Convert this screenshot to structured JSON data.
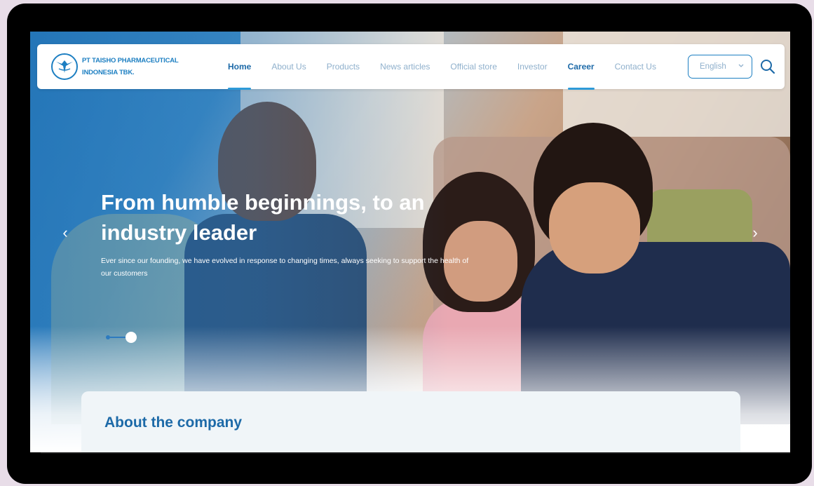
{
  "company": {
    "name_line1": "PT TAISHO PHARMACEUTICAL",
    "name_line2": "INDONESIA TBK."
  },
  "nav": {
    "items": [
      {
        "label": "Home",
        "active": true
      },
      {
        "label": "About Us",
        "active": false
      },
      {
        "label": "Products",
        "active": false
      },
      {
        "label": "News articles",
        "active": false
      },
      {
        "label": "Official store",
        "active": false
      },
      {
        "label": "Investor",
        "active": false
      },
      {
        "label": "Career",
        "active": true
      },
      {
        "label": "Contact Us",
        "active": false
      }
    ],
    "language": "English",
    "search_icon": "search-icon"
  },
  "hero": {
    "title": "From humble beginnings, to an industry leader",
    "subtitle": "Ever since our founding, we have evolved in response to changing times, always seeking to support the health of our customers",
    "prev_label": "‹",
    "next_label": "›",
    "slides_total": 2,
    "slide_active": 2
  },
  "about": {
    "title": "About the company"
  },
  "colors": {
    "brand": "#1d7fc2",
    "nav_active": "#1d6aa8",
    "nav_inactive": "#8fb0cc"
  }
}
